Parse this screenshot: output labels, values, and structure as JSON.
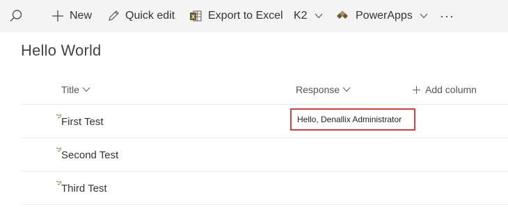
{
  "command_bar": {
    "search_icon": "search-icon",
    "new_label": "New",
    "quick_edit_label": "Quick edit",
    "export_label": "Export to Excel",
    "k2_label": "K2",
    "powerapps_label": "PowerApps",
    "more_label": "···"
  },
  "list": {
    "title": "Hello World",
    "columns": {
      "title": "Title",
      "response": "Response",
      "add_column": "Add column"
    },
    "rows": [
      {
        "title": "First Test",
        "response": "Hello, Denallix Administrator"
      },
      {
        "title": "Second Test",
        "response": ""
      },
      {
        "title": "Third Test",
        "response": ""
      }
    ]
  },
  "colors": {
    "command_bar_bg": "#f4f4f4",
    "highlight_border": "#e03a3a",
    "excel_green": "#7a6a3a"
  }
}
